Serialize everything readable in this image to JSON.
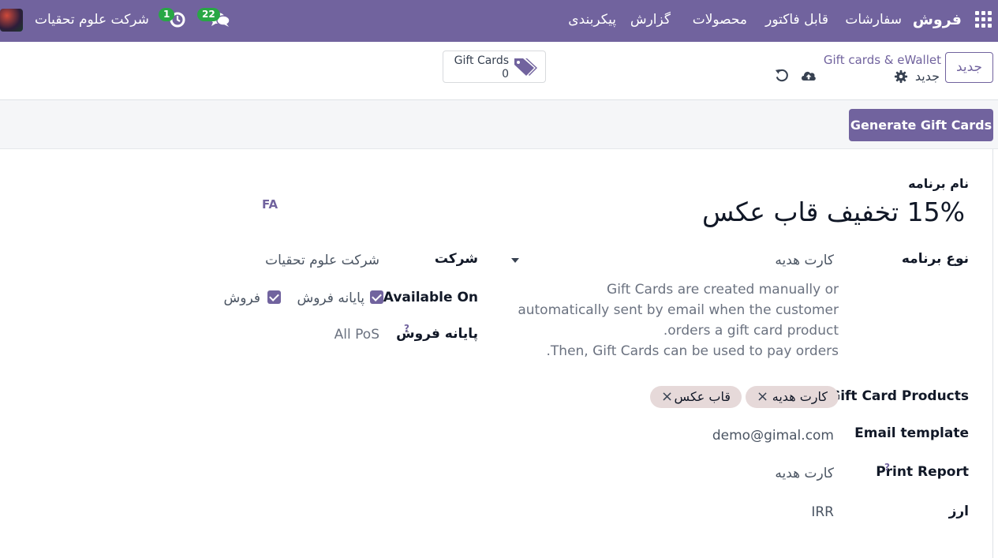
{
  "navbar": {
    "app_name": "فروش",
    "menu": [
      "سفارشات",
      "قابل فاکتور",
      "محصولات",
      "گزارش",
      "پیکربندی"
    ],
    "messages_count": "22",
    "activities_count": "1",
    "company": "شرکت علوم تحقیات"
  },
  "control_panel": {
    "new_label": "جدید",
    "breadcrumb_parent": "Gift cards & eWallet",
    "breadcrumb_current": "جدید",
    "smart_button_label": "Gift Cards",
    "smart_button_count": "0"
  },
  "statusbar": {
    "generate_label": "Generate Gift Cards"
  },
  "form": {
    "name_label": "نام برنامه",
    "program_name": "15% تخفیف قاب عکس",
    "lang_label": "FA",
    "program_type_label": "نوع برنامه",
    "program_type_value": "کارت هدیه",
    "program_type_help": "Gift Cards are created manually or automatically sent by email when the customer orders a gift card product.\nThen, Gift Cards can be used to pay orders.",
    "company_label": "شرکت",
    "company_value": "شرکت علوم تحقیات",
    "available_on_label": "Available On",
    "available_pos_label": "پایانه فروش",
    "available_sales_label": "فروش",
    "pos_label": "پایانه فروش",
    "pos_help": "?",
    "pos_value": "All PoS",
    "gift_products_label": "Gift Card Products",
    "gift_products": [
      "کارت هدیه",
      "قاب عکس"
    ],
    "email_template_label": "Email template",
    "email_template_value": "demo@gimal.com",
    "print_report_label": "Print Report",
    "print_report_help": "?",
    "print_report_value": "کارت هدیه",
    "currency_label": "ارز",
    "currency_value": "IRR"
  },
  "icons": {
    "apps": "grid-icon",
    "messages": "chat-icon",
    "activities": "clock-icon",
    "settings": "gear-icon",
    "save": "cloud-upload-icon",
    "discard": "undo-icon",
    "gift_cards": "tags-icon"
  },
  "colors": {
    "brand": "#71639e",
    "badge": "#28a745",
    "tag_bg": "#e6d9d9"
  }
}
